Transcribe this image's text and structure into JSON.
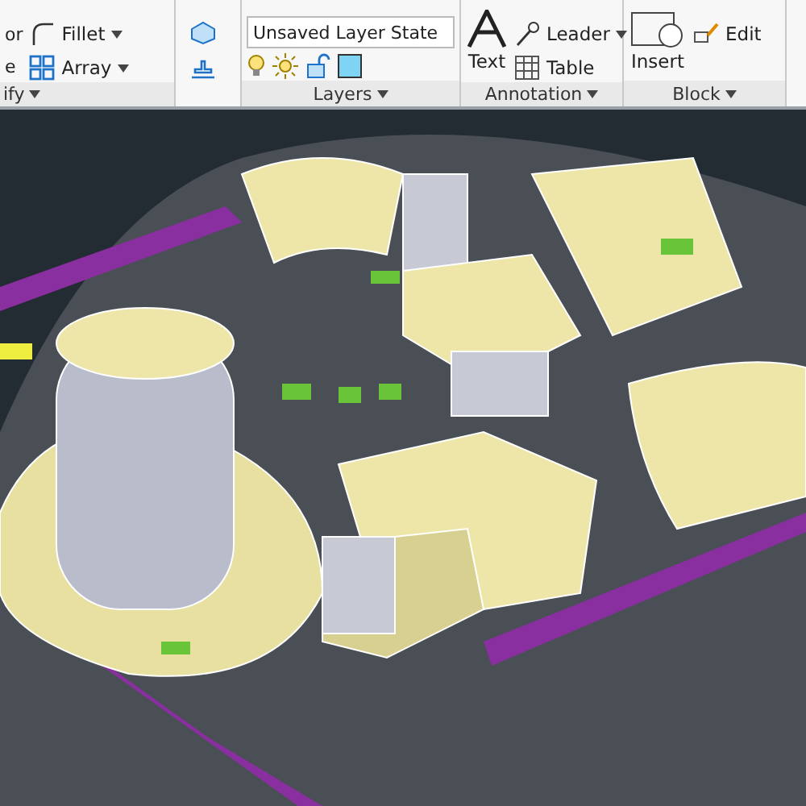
{
  "ribbon": {
    "panels": [
      {
        "kind": "modify",
        "label": "ify",
        "edge_labels": [
          "or",
          "e"
        ],
        "tools": [
          {
            "label": "Fillet"
          },
          {
            "label": "Array"
          }
        ]
      },
      {
        "kind": "icons"
      },
      {
        "kind": "layers",
        "label": "Layers",
        "layer_state": "Unsaved Layer State"
      },
      {
        "kind": "annotation",
        "label": "Annotation",
        "big_tool": "Text",
        "tools": [
          {
            "label": "Leader"
          },
          {
            "label": "Table"
          }
        ]
      },
      {
        "kind": "block",
        "label": "Block",
        "big_tool": "Insert",
        "tools": [
          {
            "label": "Edit"
          }
        ]
      }
    ]
  }
}
